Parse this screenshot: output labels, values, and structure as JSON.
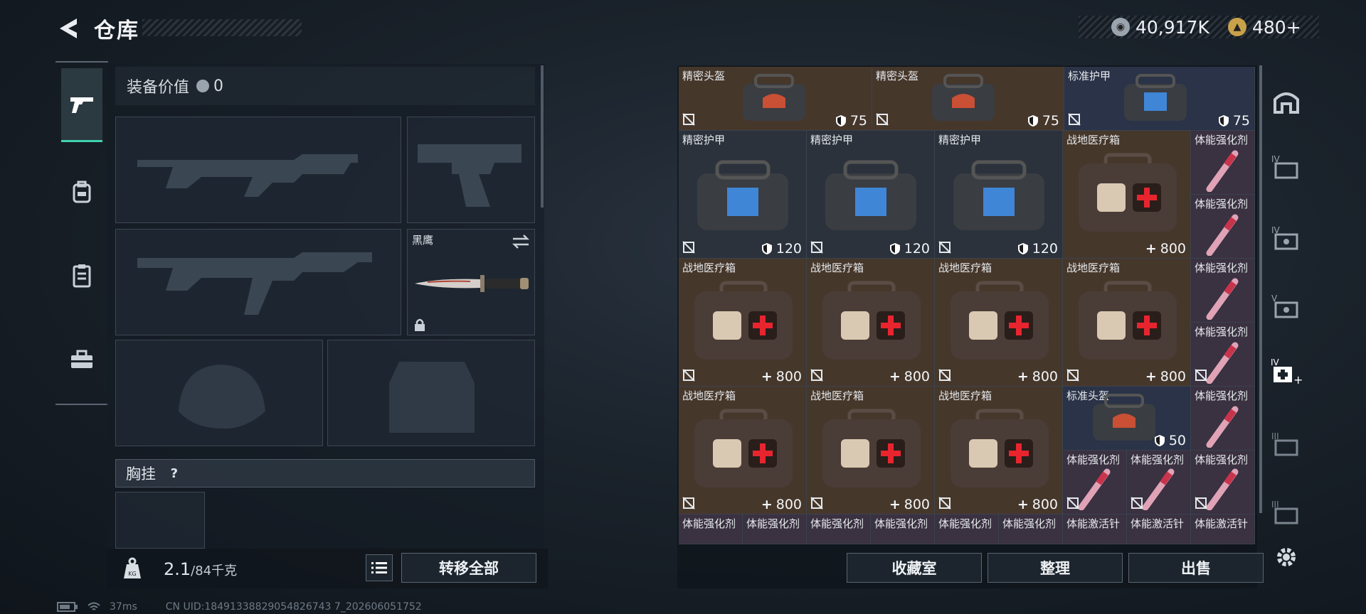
{
  "header": {
    "title": "仓库"
  },
  "currency": {
    "coins": "40,917K",
    "tickets": "480+"
  },
  "equipment": {
    "value_label": "装备价值",
    "value": "0",
    "knife_name": "黑鹰",
    "chest_label": "胸挂",
    "help": "?"
  },
  "weight": {
    "current": "2.1",
    "max": "/84千克"
  },
  "buttons": {
    "transfer_all": "转移全部",
    "collection": "收藏室",
    "organize": "整理",
    "sell": "出售"
  },
  "status": {
    "ping": "37ms",
    "uid": "CN UID:18491338829054826743 7_202606051752"
  },
  "inventory": {
    "row1": [
      {
        "name": "精密头盔",
        "value": "75"
      },
      {
        "name": "精密头盔",
        "value": "75"
      },
      {
        "name": "标准护甲",
        "value": "75"
      }
    ],
    "row2": [
      {
        "name": "精密护甲",
        "value": "120"
      },
      {
        "name": "精密护甲",
        "value": "120"
      },
      {
        "name": "精密护甲",
        "value": "120"
      },
      {
        "name": "战地医疗箱",
        "value": "800"
      }
    ],
    "row3": [
      {
        "name": "战地医疗箱",
        "value": "800"
      },
      {
        "name": "战地医疗箱",
        "value": "800"
      },
      {
        "name": "战地医疗箱",
        "value": "800"
      },
      {
        "name": "战地医疗箱",
        "value": "800"
      }
    ],
    "row4": [
      {
        "name": "战地医疗箱",
        "value": "800"
      },
      {
        "name": "战地医疗箱",
        "value": "800"
      },
      {
        "name": "战地医疗箱",
        "value": "800"
      }
    ],
    "helmet_small": {
      "name": "标准头盔",
      "value": "50"
    },
    "right_column": [
      "体能强化剂",
      "体能强化剂",
      "体能强化剂",
      "体能强化剂",
      "体能强化剂"
    ],
    "row5_small": [
      "体能强化剂",
      "体能强化剂",
      "体能强化剂"
    ],
    "row6": [
      "体能强化剂",
      "体能强化剂",
      "体能强化剂",
      "体能强化剂",
      "体能强化剂",
      "体能强化剂",
      "体能激活针",
      "体能激活针",
      "体能激活针"
    ]
  },
  "side_tabs": [
    "IV",
    "IV",
    "V",
    "IV",
    "III",
    "III"
  ]
}
